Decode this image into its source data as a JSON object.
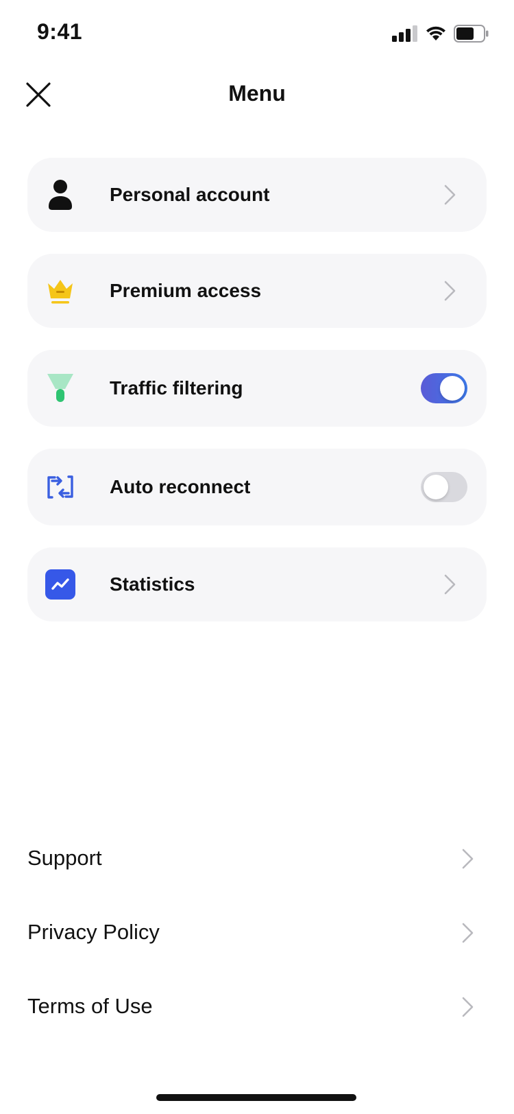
{
  "status_bar": {
    "time": "9:41",
    "icons": [
      "cellular-signal-icon",
      "wifi-icon",
      "battery-icon"
    ]
  },
  "header": {
    "title": "Menu",
    "close_icon": "close-icon"
  },
  "menu": {
    "items": [
      {
        "label": "Personal account",
        "icon": "person-icon",
        "control": "chevron"
      },
      {
        "label": "Premium access",
        "icon": "crown-icon",
        "control": "chevron",
        "icon_color": "#f5c518"
      },
      {
        "label": "Traffic filtering",
        "icon": "filter-funnel-icon",
        "control": "toggle",
        "toggle_on": true,
        "icon_color": "#34c97a"
      },
      {
        "label": "Auto reconnect",
        "icon": "reconnect-arrows-icon",
        "control": "toggle",
        "toggle_on": false,
        "icon_color": "#3a5fe0"
      },
      {
        "label": "Statistics",
        "icon": "chart-trend-icon",
        "control": "chevron",
        "icon_color": "#3658e8"
      }
    ]
  },
  "links": {
    "items": [
      {
        "label": "Support"
      },
      {
        "label": "Privacy Policy"
      },
      {
        "label": "Terms of Use"
      }
    ]
  },
  "colors": {
    "card_background": "#f6f6f8",
    "toggle_on_gradient": [
      "#5a5bd6",
      "#3c78e8"
    ],
    "toggle_off": "#d9d9de",
    "chevron": "#b9b9be",
    "text": "#111111"
  }
}
